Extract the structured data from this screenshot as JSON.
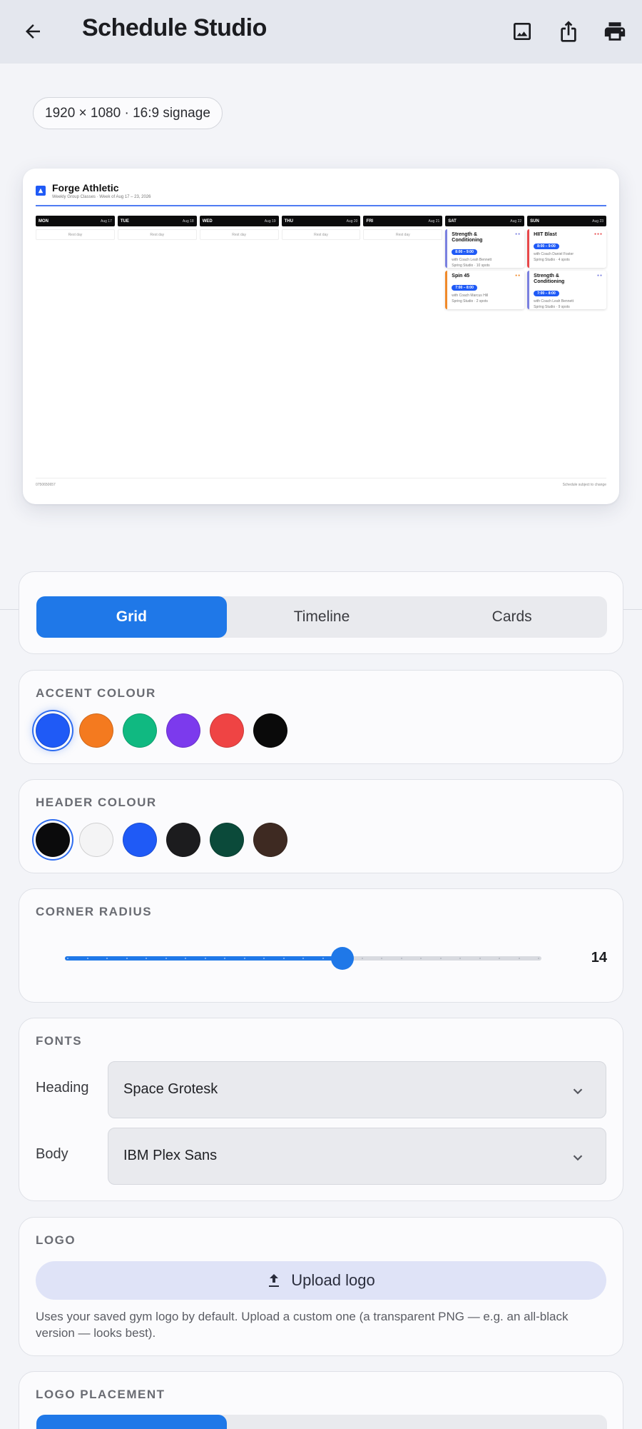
{
  "appbar": {
    "title": "Schedule Studio"
  },
  "preview": {
    "size_chip": "1920 × 1080 · 16:9 signage",
    "brand": "Forge Athletic",
    "subtitle": "Weekly Group Classes  ·  Week of Aug 17 – 23, 2026",
    "footer_left": "0750650657",
    "footer_right": "Schedule subject to change",
    "days": [
      {
        "name": "MON",
        "date": "Aug 17",
        "rest": "Rest day"
      },
      {
        "name": "TUE",
        "date": "Aug 18",
        "rest": "Rest day"
      },
      {
        "name": "WED",
        "date": "Aug 19",
        "rest": "Rest day"
      },
      {
        "name": "THU",
        "date": "Aug 20",
        "rest": "Rest day"
      },
      {
        "name": "FRI",
        "date": "Aug 21",
        "rest": "Rest day"
      },
      {
        "name": "SAT",
        "date": "Aug 22"
      },
      {
        "name": "SUN",
        "date": "Aug 23"
      }
    ],
    "classes": {
      "sat1": {
        "name": "Strength & Conditioning",
        "time": "8:00 – 9:00",
        "coach": "with Coach Leah Bennett",
        "meta": "Spring Studio  ·  10 spots",
        "color": "#7a80e0"
      },
      "sat2": {
        "name": "Spin 45",
        "time": "7:00 – 8:00",
        "coach": "with Coach Marcus Hill",
        "meta": "Spring Studio  ·  2 spots",
        "color": "#f08a2a"
      },
      "sun1": {
        "name": "HIIT Blast",
        "time": "8:00 – 9:00",
        "coach": "with Coach Daniel Foster",
        "meta": "Spring Studio  ·  4 spots",
        "color": "#e8484a"
      },
      "sun2": {
        "name": "Strength & Conditioning",
        "time": "7:00 – 8:00",
        "coach": "with Coach Leah Bennett",
        "meta": "Spring Studio  ·  9 spots",
        "color": "#7a80e0"
      }
    }
  },
  "layout_mode": {
    "options": [
      "Grid",
      "Timeline",
      "Cards"
    ],
    "selected": "Grid"
  },
  "accent": {
    "label": "ACCENT COLOUR",
    "colors": [
      "#1f5af6",
      "#f47a1f",
      "#10b981",
      "#7c3aed",
      "#ef4444",
      "#0a0a0a"
    ],
    "selected": 0
  },
  "header_colour": {
    "label": "HEADER COLOUR",
    "colors": [
      "#0b0b0c",
      "#f4f4f5",
      "#1f5af6",
      "#1c1c1e",
      "#0b4a3a",
      "#3e2a22"
    ],
    "selected": 0
  },
  "corner_radius": {
    "label": "CORNER RADIUS",
    "value": "14",
    "fraction": 0.583
  },
  "fonts": {
    "label": "FONTS",
    "heading_label": "Heading",
    "heading_value": "Space Grotesk",
    "body_label": "Body",
    "body_value": "IBM Plex Sans"
  },
  "logo": {
    "label": "LOGO",
    "upload_label": "Upload logo",
    "hint": "Uses your saved gym logo by default. Upload a custom one (a transparent PNG — e.g. an all-black version — looks best)."
  },
  "logo_placement": {
    "label": "LOGO PLACEMENT"
  }
}
